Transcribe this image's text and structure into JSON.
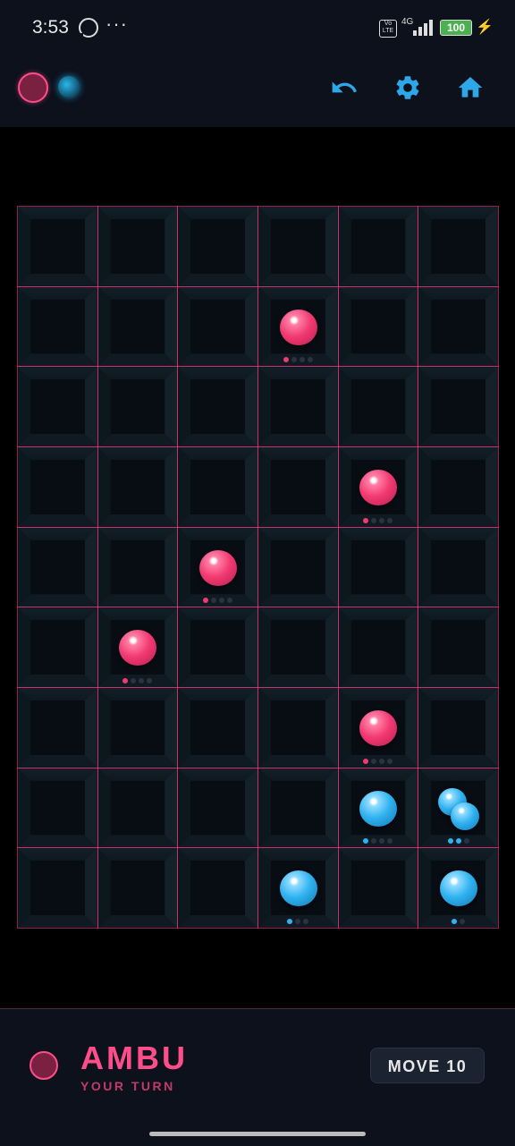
{
  "status_bar": {
    "time": "3:53",
    "dots": "···",
    "volte": "Vo LTE",
    "network": "4G",
    "battery": "100"
  },
  "topbar": {
    "icons": [
      "undo-icon",
      "settings-gear-icon",
      "home-icon"
    ],
    "accent_color": "#2ea7e8"
  },
  "colors": {
    "pink": "#f23a72",
    "blue": "#2fb2ef",
    "grid_line": "#ff3c8c"
  },
  "board": {
    "cols": 6,
    "rows": 9,
    "cells": [
      {
        "row": 1,
        "col": 3,
        "player": "pink",
        "orbs": 1,
        "capacity": 4
      },
      {
        "row": 3,
        "col": 4,
        "player": "pink",
        "orbs": 1,
        "capacity": 4
      },
      {
        "row": 4,
        "col": 2,
        "player": "pink",
        "orbs": 1,
        "capacity": 4
      },
      {
        "row": 5,
        "col": 1,
        "player": "pink",
        "orbs": 1,
        "capacity": 4
      },
      {
        "row": 6,
        "col": 4,
        "player": "pink",
        "orbs": 1,
        "capacity": 4
      },
      {
        "row": 7,
        "col": 4,
        "player": "blue",
        "orbs": 1,
        "capacity": 4
      },
      {
        "row": 7,
        "col": 5,
        "player": "blue",
        "orbs": 2,
        "capacity": 3
      },
      {
        "row": 8,
        "col": 3,
        "player": "blue",
        "orbs": 1,
        "capacity": 3
      },
      {
        "row": 8,
        "col": 5,
        "player": "blue",
        "orbs": 1,
        "capacity": 2
      }
    ]
  },
  "current_player": {
    "name": "AMBU",
    "status": "YOUR TURN",
    "move_label": "MOVE 10"
  }
}
